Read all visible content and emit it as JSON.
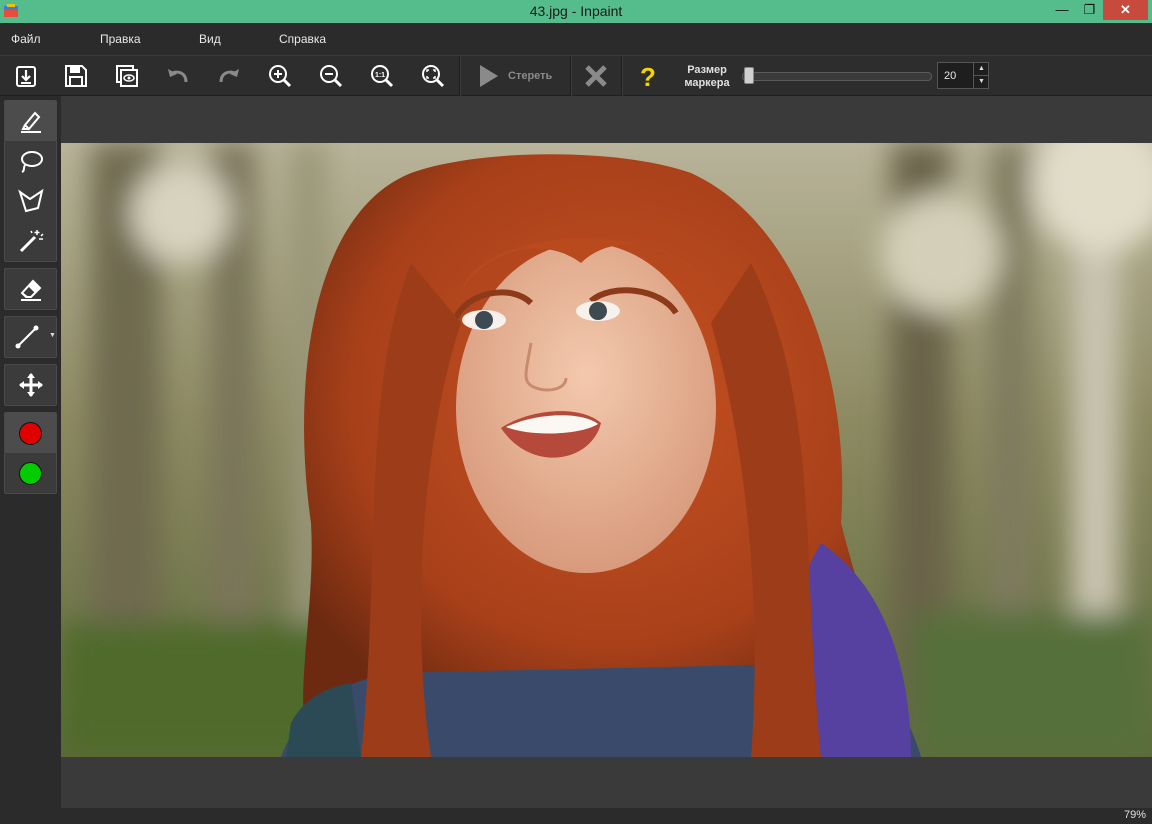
{
  "window": {
    "title": "43.jpg - Inpaint",
    "min": "—",
    "max": "❐",
    "close": "✕"
  },
  "menu": {
    "file": "Файл",
    "edit": "Правка",
    "view": "Вид",
    "help": "Справка"
  },
  "toolbar": {
    "erase_label": "Стереть",
    "marker_size_label_1": "Размер",
    "marker_size_label_2": "маркера",
    "marker_size_value": "20",
    "marker_size_slider": 0.05,
    "icons": [
      "open-icon",
      "save-icon",
      "preview-icon",
      "undo-icon",
      "redo-icon",
      "zoom-in-icon",
      "zoom-out-icon",
      "zoom-actual-icon",
      "zoom-fit-icon",
      "play-icon",
      "cancel-icon",
      "help-icon"
    ]
  },
  "tools": [
    "marker-icon",
    "lasso-icon",
    "polygon-lasso-icon",
    "magic-wand-icon",
    "eraser-icon",
    "line-icon",
    "move-icon"
  ],
  "colors": {
    "remove": "#e00000",
    "keep": "#00cc00"
  },
  "status": {
    "zoom": "79%"
  }
}
